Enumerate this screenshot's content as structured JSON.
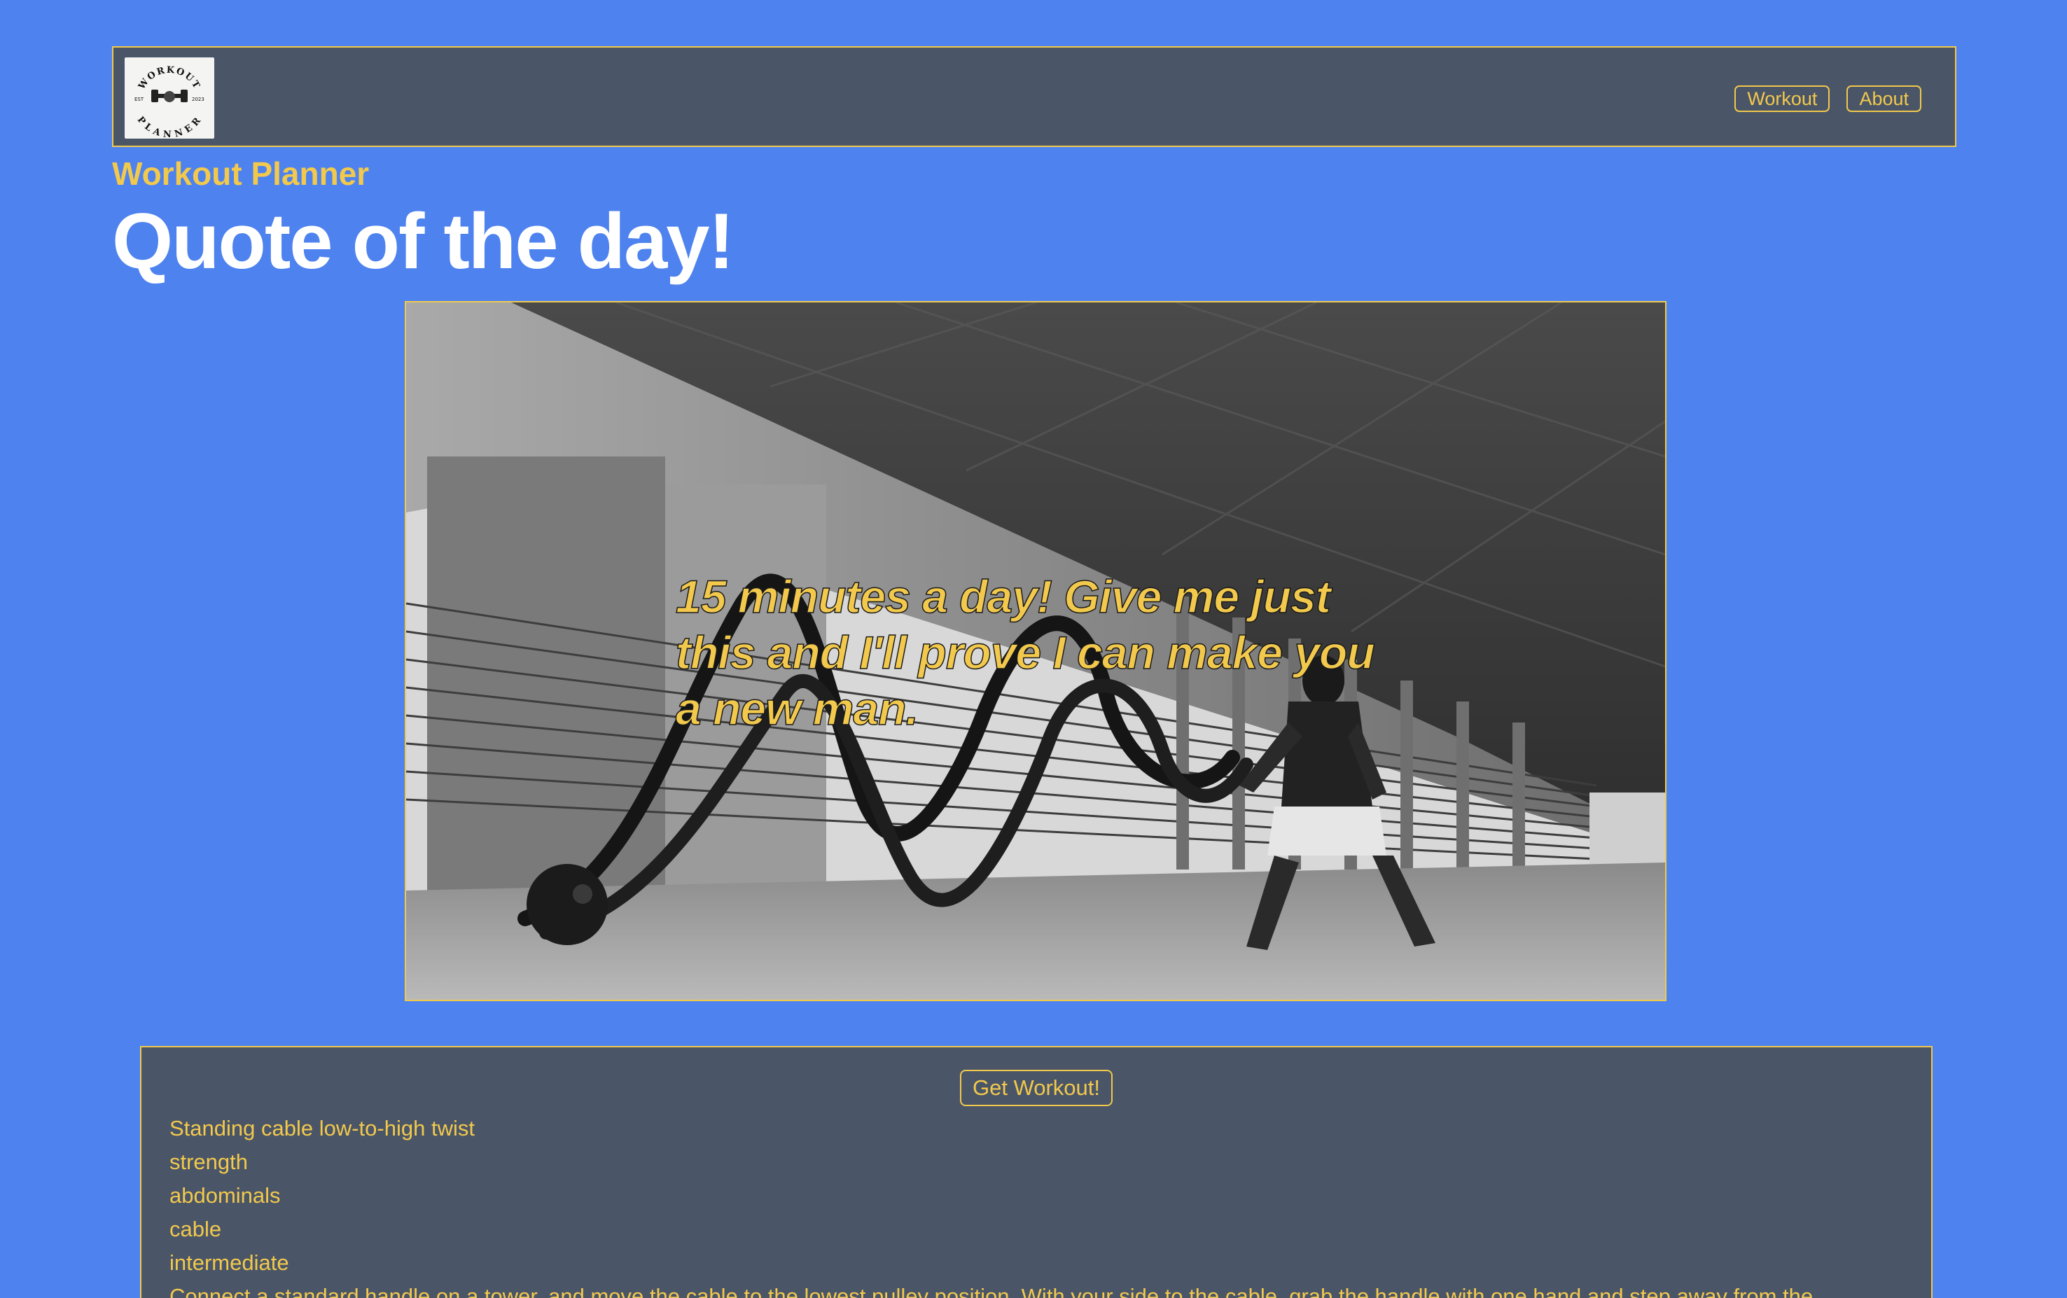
{
  "nav": {
    "logo_text_top": "WORKOUT",
    "logo_text_bottom": "PLANNER",
    "logo_est": "EST",
    "logo_year": "2023",
    "links": [
      {
        "label": "Workout"
      },
      {
        "label": "About"
      }
    ]
  },
  "header": {
    "brand": "Workout Planner",
    "title": "Quote of the day!"
  },
  "hero": {
    "quote": "15 minutes a day! Give me just this and I'll prove I can make you a new man."
  },
  "workout": {
    "button_label": "Get Workout!",
    "name": "Standing cable low-to-high twist",
    "type": "strength",
    "muscle": "abdominals",
    "equipment": "cable",
    "difficulty": "intermediate",
    "instructions": "Connect a standard handle on a tower, and move the cable to the lowest pulley position. With your side to the cable, grab the handle with one hand and step away from the"
  },
  "colors": {
    "page_bg": "#4d82ef",
    "panel_bg": "#4a5568",
    "accent": "#f2c94c",
    "title": "#ffffff"
  }
}
